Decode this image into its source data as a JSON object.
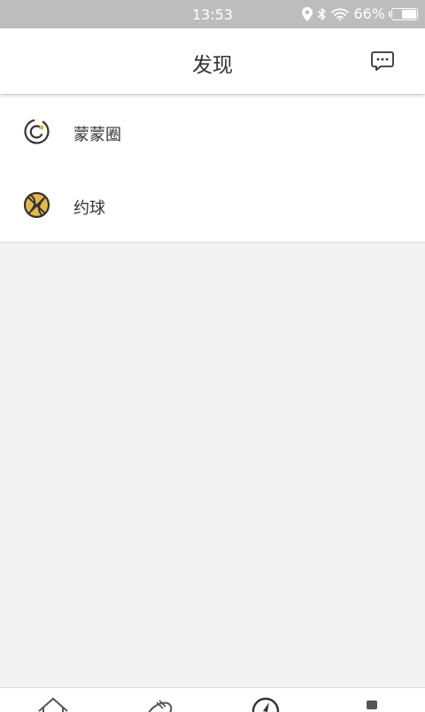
{
  "status_bar": {
    "time": "13:53",
    "battery_text": "66%",
    "battery_level": 0.66,
    "icons": [
      "location-icon",
      "bluetooth-icon",
      "wifi-icon",
      "battery-icon"
    ]
  },
  "header": {
    "title": "发现",
    "action_icon": "chat-bubble-icon"
  },
  "list": {
    "items": [
      {
        "label": "蒙蒙圈",
        "icon": "circle-icon"
      },
      {
        "label": "约球",
        "icon": "basketball-icon"
      }
    ]
  },
  "tab_bar": {
    "icons": [
      "home-icon",
      "football-icon",
      "compass-icon",
      "profile-icon"
    ]
  },
  "colors": {
    "status_bar": "#bdbdbd",
    "accent": "#e8b74a",
    "icon_stroke": "#333333",
    "background": "#f3f3f3"
  }
}
